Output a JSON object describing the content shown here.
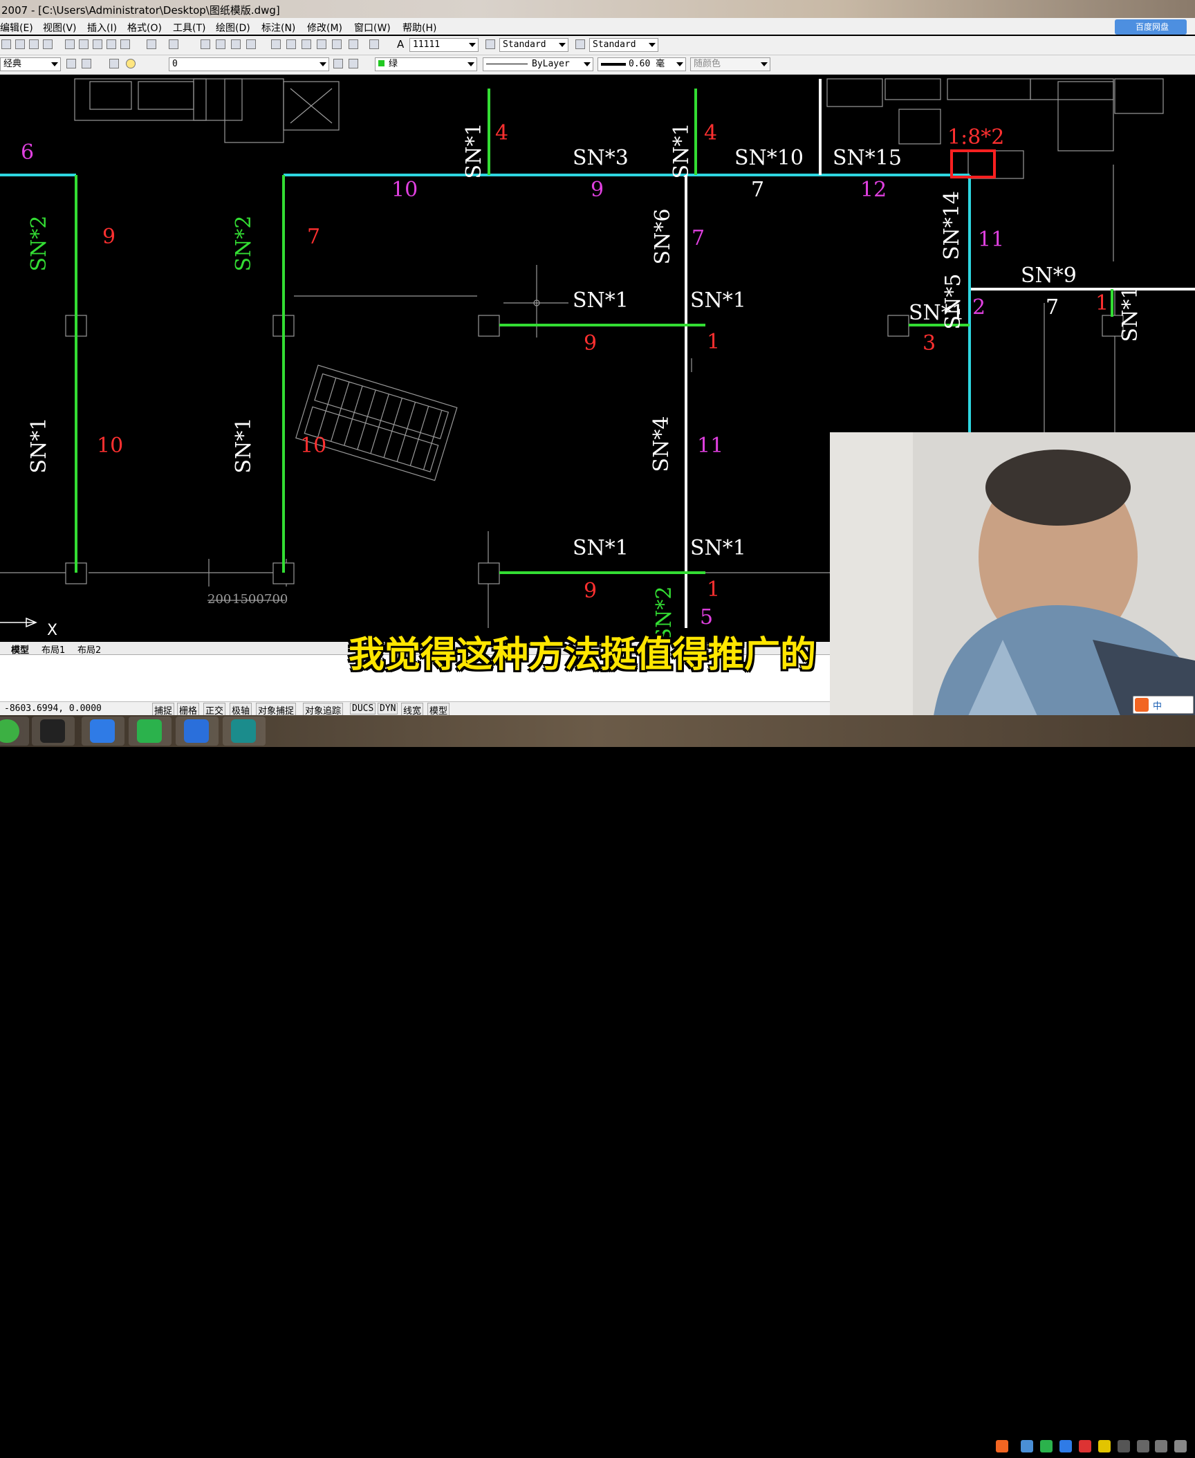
{
  "window": {
    "title": "2007 - [C:\\Users\\Administrator\\Desktop\\图纸模版.dwg]"
  },
  "menu": [
    "编辑(E)",
    "视图(V)",
    "插入(I)",
    "格式(O)",
    "工具(T)",
    "绘图(D)",
    "标注(N)",
    "修改(M)",
    "窗口(W)",
    "帮助(H)"
  ],
  "toolbar1": {
    "text_height": "11111",
    "text_style": "Standard",
    "dim_style": "Standard"
  },
  "toolbar2": {
    "workspace": "经典",
    "layer": "0",
    "color": "绿",
    "linetype": "ByLayer",
    "lineweight": "0.60 毫",
    "plotstyle": "随颜色"
  },
  "cloud_badge": "百度网盘",
  "drawing": {
    "labels": [
      {
        "t": "6",
        "c": "#e040e0"
      },
      {
        "t": "SN*1",
        "c": "#fff"
      },
      {
        "t": "4",
        "c": "#ff3030"
      },
      {
        "t": "SN*1",
        "c": "#fff"
      },
      {
        "t": "4",
        "c": "#ff3030"
      },
      {
        "t": "SN*3",
        "c": "#fff"
      },
      {
        "t": "SN*10",
        "c": "#fff"
      },
      {
        "t": "SN*15",
        "c": "#fff"
      },
      {
        "t": "1:8*2",
        "c": "#ff3030"
      },
      {
        "t": "10",
        "c": "#e040e0"
      },
      {
        "t": "9",
        "c": "#e040e0"
      },
      {
        "t": "7",
        "c": "#fff"
      },
      {
        "t": "12",
        "c": "#e040e0"
      },
      {
        "t": "SN*2",
        "c": "#33dd33"
      },
      {
        "t": "9",
        "c": "#ff3030"
      },
      {
        "t": "SN*2",
        "c": "#33dd33"
      },
      {
        "t": "7",
        "c": "#ff3030"
      },
      {
        "t": "SN*6",
        "c": "#fff"
      },
      {
        "t": "7",
        "c": "#e040e0"
      },
      {
        "t": "SN*14",
        "c": "#fff"
      },
      {
        "t": "11",
        "c": "#e040e0"
      },
      {
        "t": "SN*9",
        "c": "#fff"
      },
      {
        "t": "SN*1",
        "c": "#fff"
      },
      {
        "t": "SN*1",
        "c": "#fff"
      },
      {
        "t": "SN*5",
        "c": "#fff"
      },
      {
        "t": "SN*1",
        "c": "#fff"
      },
      {
        "t": "2",
        "c": "#e040e0"
      },
      {
        "t": "7",
        "c": "#fff"
      },
      {
        "t": "1",
        "c": "#ff3030"
      },
      {
        "t": "SN*1",
        "c": "#fff"
      },
      {
        "t": "9",
        "c": "#ff3030"
      },
      {
        "t": "1",
        "c": "#ff3030"
      },
      {
        "t": "3",
        "c": "#ff3030"
      },
      {
        "t": "SN*1",
        "c": "#fff"
      },
      {
        "t": "10",
        "c": "#ff3030"
      },
      {
        "t": "SN*1",
        "c": "#fff"
      },
      {
        "t": "10",
        "c": "#ff3030"
      },
      {
        "t": "SN*4",
        "c": "#fff"
      },
      {
        "t": "11",
        "c": "#e040e0"
      },
      {
        "t": "SN*1",
        "c": "#fff"
      },
      {
        "t": "SN*1",
        "c": "#fff"
      },
      {
        "t": "9",
        "c": "#ff3030"
      },
      {
        "t": "1",
        "c": "#ff3030"
      },
      {
        "t": "SN*2",
        "c": "#33dd33"
      },
      {
        "t": "5",
        "c": "#e040e0"
      },
      {
        "t": "200",
        "c": "#888"
      },
      {
        "t": "1500",
        "c": "#888"
      },
      {
        "t": "700",
        "c": "#888"
      },
      {
        "t": "X",
        "c": "#fff"
      }
    ]
  },
  "tabs": [
    "模型",
    "布局1",
    "布局2"
  ],
  "status": {
    "coords": "-8603.6994, 0.0000",
    "buttons": [
      "捕捉",
      "栅格",
      "正交",
      "极轴",
      "对象捕捉",
      "对象追踪",
      "DUCS",
      "DYN",
      "线宽",
      "模型"
    ]
  },
  "subtitle": "我觉得这种方法挺值得推广的",
  "ime": {
    "label": "中"
  }
}
